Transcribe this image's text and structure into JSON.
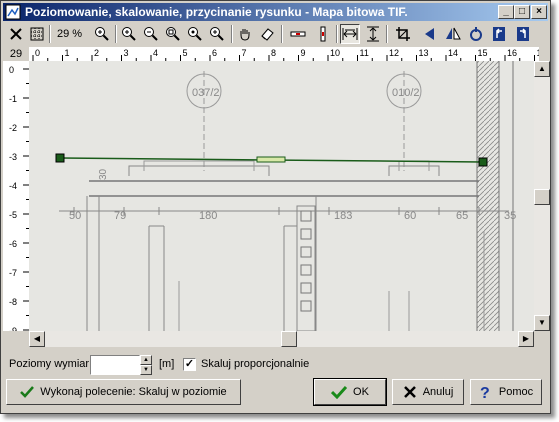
{
  "window": {
    "title": "Poziomowanie, skalowanie, przycinanie rysunku - Mapa bitowa TIF."
  },
  "title_buttons": {
    "minimize": "_",
    "maximize": "□",
    "close": "×"
  },
  "toolbar": {
    "zoom_level": "29 %",
    "icons": [
      "close-icon",
      "grid-icon",
      "zoom-fit-icon",
      "zoom-in-icon",
      "zoom-out-icon",
      "zoom-window-icon",
      "zoom-all-icon",
      "zoom-dynamic-icon",
      "pan-hand-icon",
      "eraser-icon",
      "level-horizontal-icon",
      "level-vertical-icon",
      "scale-horizontal-icon",
      "scale-vertical-icon",
      "crop-icon",
      "mirror-left-icon",
      "mirror-both-icon",
      "rotate-icon",
      "rotate-left-icon",
      "rotate-right-icon"
    ]
  },
  "rulers": {
    "corner": "29",
    "horizontal": [
      "0",
      "1",
      "2",
      "3",
      "4",
      "5",
      "6",
      "7",
      "8",
      "9",
      "10",
      "11",
      "12",
      "13",
      "14",
      "15",
      "16",
      "17"
    ],
    "vertical": [
      "0",
      "-1",
      "-2",
      "-3",
      "-4",
      "-5",
      "-6",
      "-7",
      "-8",
      "-9"
    ]
  },
  "drawing": {
    "labels": [
      "037/2",
      "010/2",
      "50",
      "79",
      "180",
      "183",
      "60",
      "65",
      "35",
      "30"
    ]
  },
  "form": {
    "horizontal_dim_label": "Poziomy wymiar",
    "horizontal_dim_value": "",
    "unit_label": "[m]",
    "scale_proportional_label": "Skaluj proporcjonalnie",
    "scale_proportional_checked": "✓"
  },
  "buttons": {
    "execute": "Wykonaj polecenie: Skaluj w poziomie",
    "ok": "OK",
    "cancel": "Anuluj",
    "help": "Pomoc"
  },
  "colors": {
    "titlebar_start": "#0a246a",
    "titlebar_end": "#a6caf0",
    "reference_line": "#1a5c1a"
  }
}
